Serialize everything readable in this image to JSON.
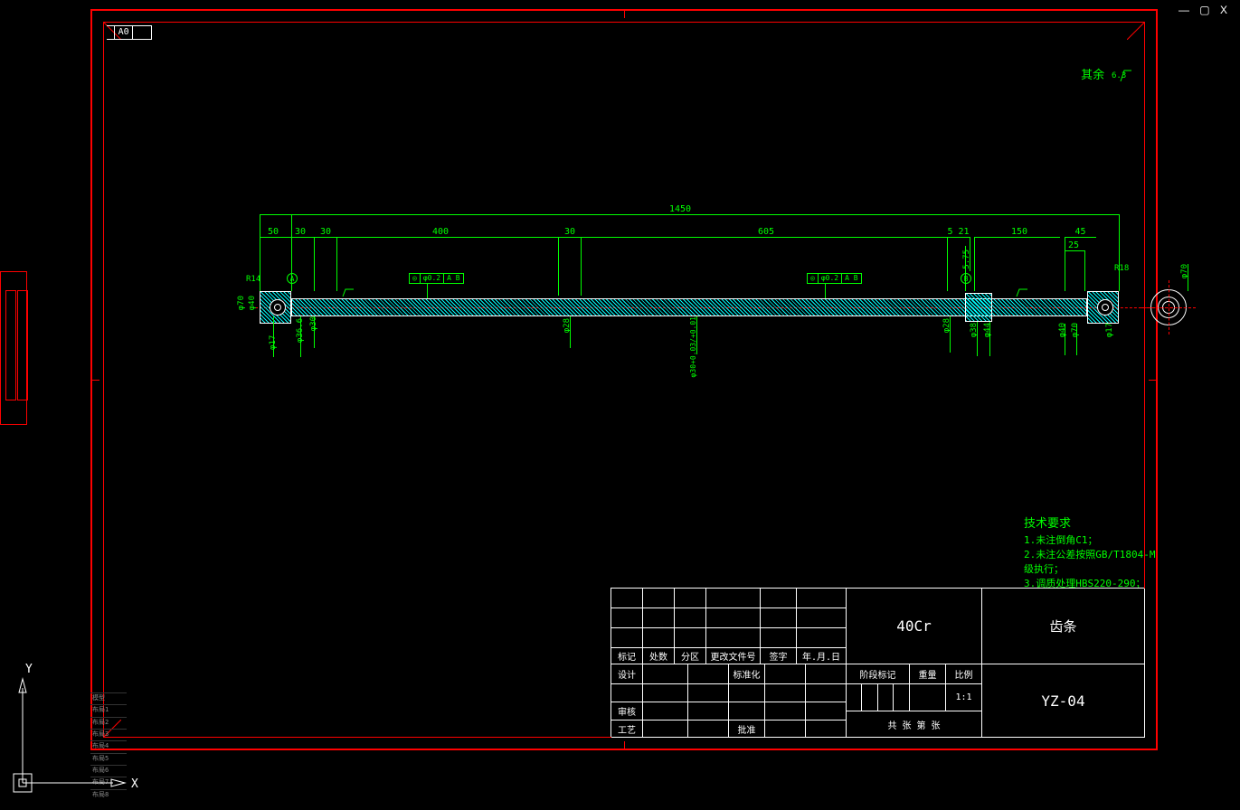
{
  "window": {
    "min": "—",
    "max": "▢",
    "close": "X"
  },
  "paper_size": "A0",
  "surface_all_note": "其余",
  "tech_requirements": {
    "title": "技术要求",
    "items": [
      "1.未注倒角C1；",
      "2.未注公差按照GB/T1804-M级执行；",
      "3.调质处理HBS220-290；"
    ]
  },
  "dimensions": {
    "overall_length": "1450",
    "seg_50": "50",
    "seg_30a": "30",
    "seg_30b": "30",
    "seg_400": "400",
    "seg_30c": "30",
    "seg_605": "605",
    "seg_521": "5 21",
    "seg_150": "150",
    "seg_45": "45",
    "seg_25": "25",
    "r14": "R14",
    "r18": "R18",
    "d70_l": "φ70",
    "d40_l": "φ40",
    "d17_l": "φ17",
    "d36_l6": "φ36.6",
    "d30_l": "φ30",
    "d28": "φ28",
    "d30_tol": "φ30+0.03/+0.01",
    "d28_r": "φ28",
    "d38": "φ38",
    "d44": "φ44",
    "d40_r": "φ40",
    "d70_r": "φ70",
    "d17_r": "φ17",
    "d70_end": "φ70",
    "s75": "5.75"
  },
  "fcf1": {
    "sym": "◎",
    "tol": "φ0.2",
    "ref": "A B"
  },
  "fcf2": {
    "sym": "◎",
    "tol": "φ0.2",
    "ref": "A B"
  },
  "datum_a": "A",
  "datum_b": "B",
  "title_block": {
    "material": "40Cr",
    "part_name": "齿条",
    "drawing_no": "YZ-04",
    "scale": "1:1",
    "headers_row1": [
      "标记",
      "处数",
      "分区",
      "更改文件号",
      "签字",
      "年.月.日"
    ],
    "row_design": "设计",
    "row_std": "标准化",
    "row_check": "审核",
    "row_process": "工艺",
    "row_approve": "批准",
    "stage_mark": "阶段标记",
    "weight": "重量",
    "scale_label": "比例",
    "sheets": "共    张  第    张"
  },
  "ucs": {
    "x": "X",
    "y": "Y"
  },
  "tabs": [
    "模型",
    "布局1",
    "布局2",
    "布局3",
    "布局4",
    "布局5",
    "布局6",
    "布局7",
    "布局8"
  ]
}
